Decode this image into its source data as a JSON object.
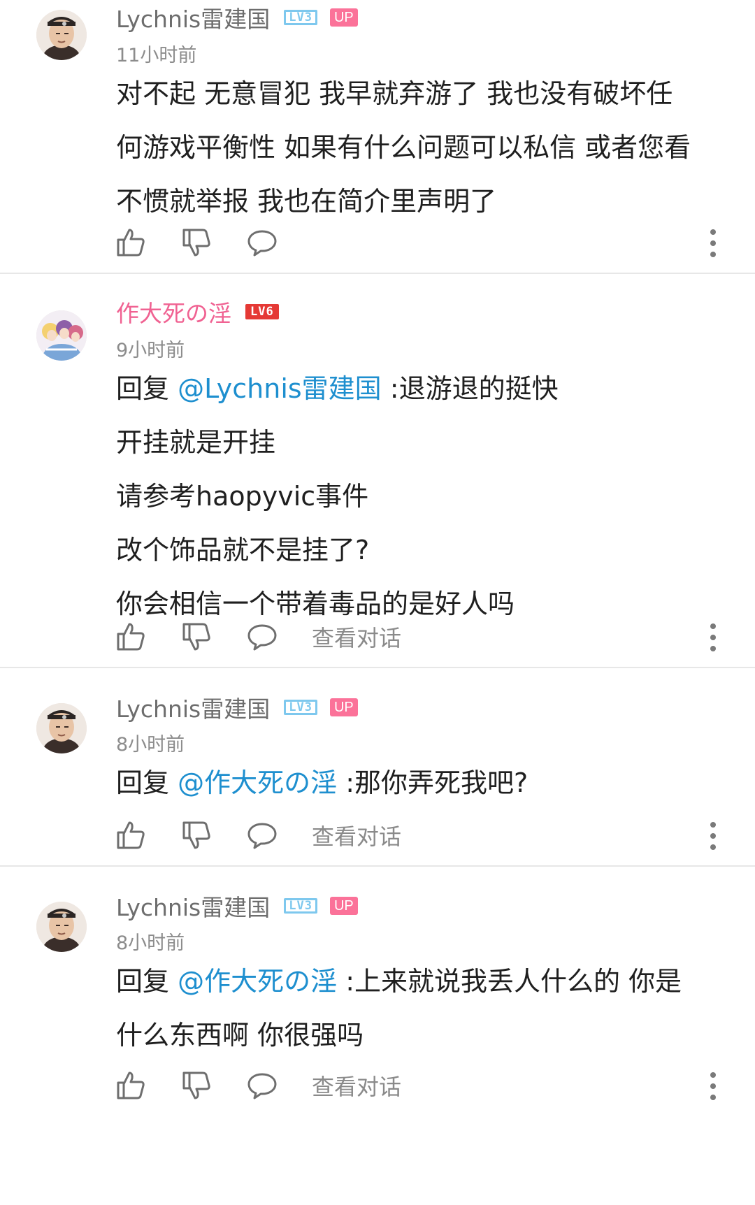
{
  "comments": [
    {
      "username": "Lychnis雷建国",
      "level": "LV3",
      "up_badge": "UP",
      "time": "11小时前",
      "lines": [
        "对不起 无意冒犯 我早就弃游了 我也没有破坏任",
        "何游戏平衡性 如果有什么问题可以私信 或者您看",
        "不惯就举报 我也在简介里声明了"
      ]
    },
    {
      "username": "作大死の淫",
      "level": "LV6",
      "time": "9小时前",
      "reply_prefix": "回复 ",
      "mention": "@Lychnis雷建国",
      "first_line_rest": " :退游退的挺快",
      "lines": [
        "开挂就是开挂",
        "请参考haopyvic事件",
        "改个饰品就不是挂了?",
        "你会相信一个带着毒品的是好人吗"
      ],
      "view_conversation": "查看对话"
    },
    {
      "username": "Lychnis雷建国",
      "level": "LV3",
      "up_badge": "UP",
      "time": "8小时前",
      "reply_prefix": "回复 ",
      "mention": "@作大死の淫",
      "first_line_rest": " :那你弄死我吧?",
      "view_conversation": "查看对话"
    },
    {
      "username": "Lychnis雷建国",
      "level": "LV3",
      "up_badge": "UP",
      "time": "8小时前",
      "reply_prefix": "回复 ",
      "mention": "@作大死の淫",
      "first_line_rest": " :上来就说我丢人什么的 你是",
      "lines": [
        "什么东西啊 你很强吗"
      ],
      "view_conversation": "查看对话"
    }
  ],
  "icons": [
    "like-icon",
    "dislike-icon",
    "reply-icon",
    "more-icon"
  ],
  "colors": {
    "mention": "#1e8fcf",
    "up_badge": "#fb7299",
    "lv3": "#7ec8ee",
    "lv6": "#e53935",
    "pink_name": "#f06292"
  }
}
